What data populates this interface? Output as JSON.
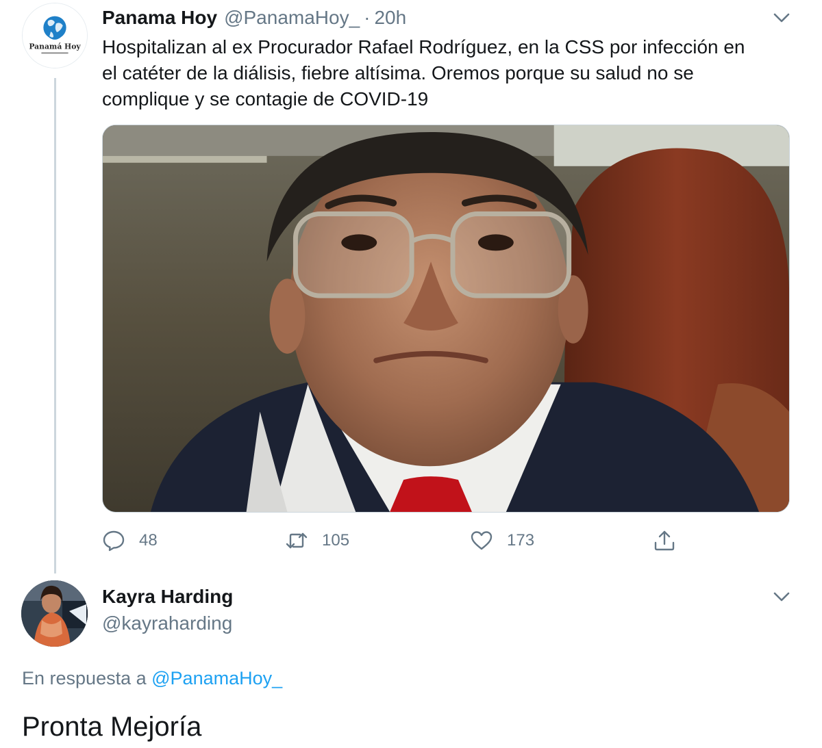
{
  "tweet": {
    "author_name": "Panama Hoy",
    "author_handle": "@PanamaHoy_",
    "separator": "·",
    "time": "20h",
    "text": "Hospitalizan al ex Procurador   Rafael Rodríguez, en la CSS por infección en\nel catéter de la diálisis, fiebre altísima. Oremos porque su salud no se\ncomplique y se contagie de COVID-19",
    "avatar_logo_text": "Panamá Hoy",
    "actions": {
      "reply_count": "48",
      "retweet_count": "105",
      "like_count": "173"
    }
  },
  "reply": {
    "author_name": "Kayra Harding",
    "author_handle": "@kayraharding",
    "reply_prefix": "En respuesta a",
    "reply_to_handle": "@PanamaHoy_",
    "text": "Pronta Mejoría"
  },
  "icons": {
    "menu": "chevron-down-icon",
    "reply": "speech-bubble-icon",
    "retweet": "retweet-icon",
    "like": "heart-icon",
    "share": "share-upload-icon"
  },
  "colors": {
    "text_primary": "#14171a",
    "text_secondary": "#657786",
    "link": "#1da1f2",
    "thread_line": "#ccd6dd"
  }
}
